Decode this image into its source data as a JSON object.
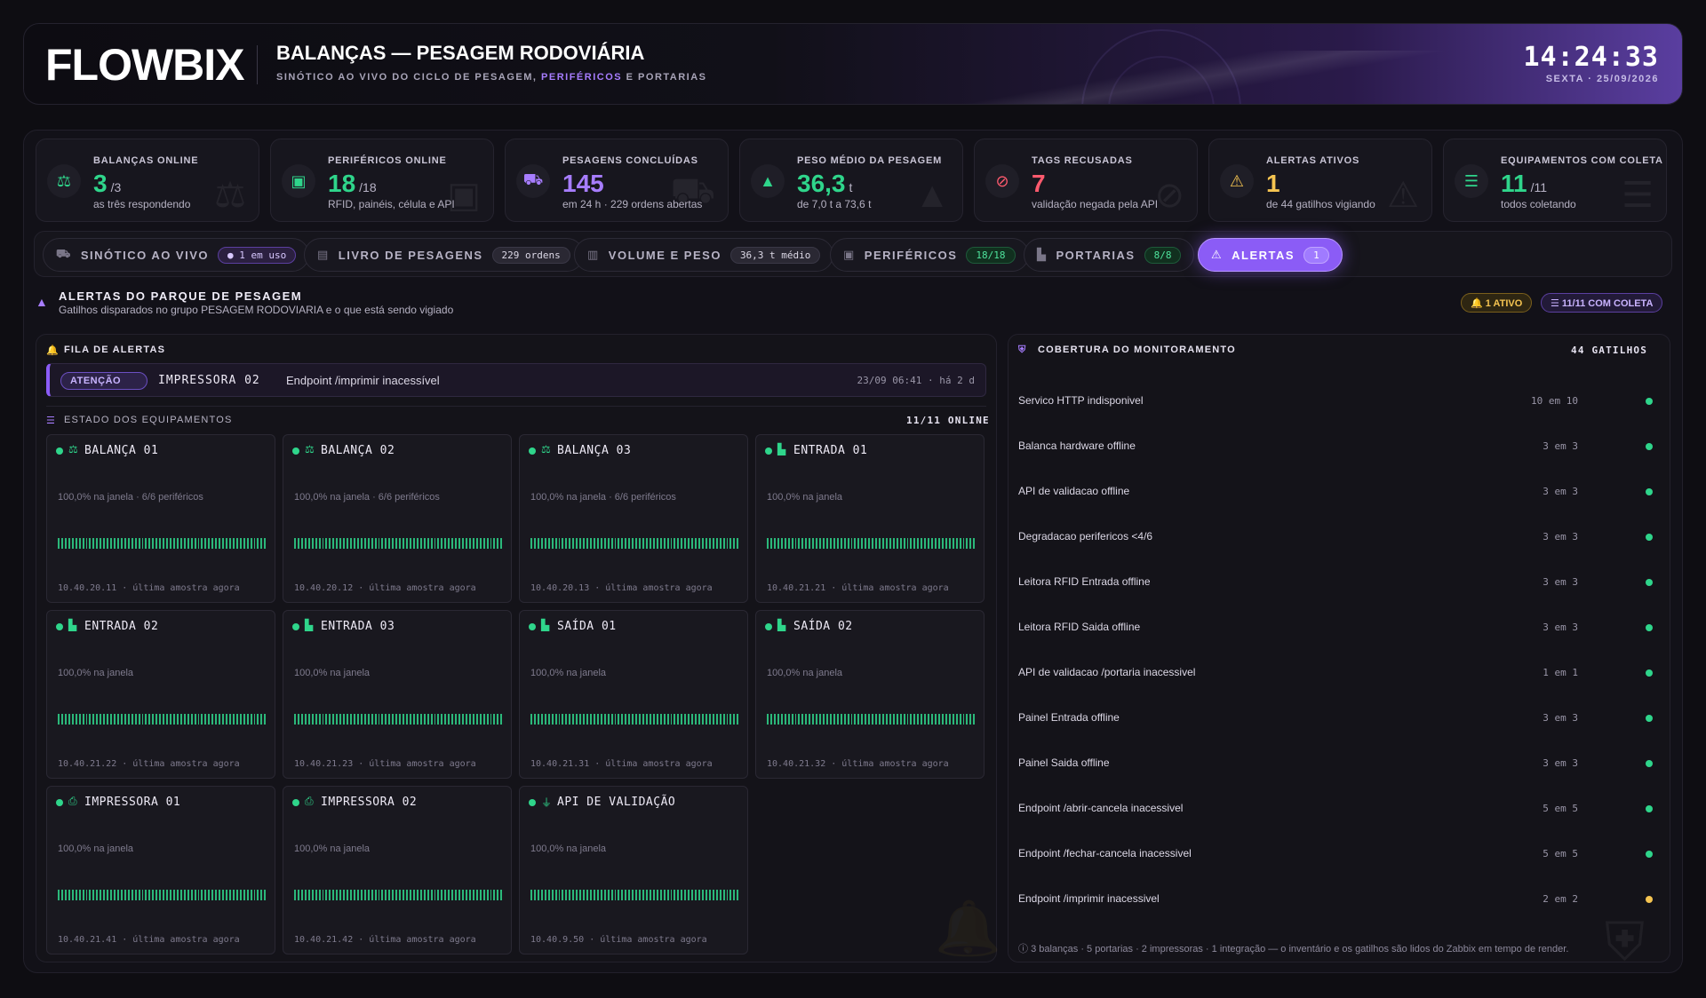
{
  "header": {
    "logo": "FLOWBIX",
    "title": "BALANÇAS — PESAGEM RODOVIÁRIA",
    "subtitle_pre": "SINÓTICO AO VIVO DO CICLO DE PESAGEM,",
    "subtitle_hl": "PERIFÉRICOS",
    "subtitle_post": "E PORTARIAS",
    "clock": "14:24:33",
    "date": "SEXTA · 25/09/2026"
  },
  "kpis": [
    {
      "icon": "scale-icon",
      "label": "BALANÇAS ONLINE",
      "value": "3",
      "unit": "/3",
      "desc": "as três respondendo",
      "color": "#2fd58b"
    },
    {
      "icon": "chip-icon",
      "label": "PERIFÉRICOS ONLINE",
      "value": "18",
      "unit": "/18",
      "desc": "RFID, painéis, célula e API",
      "color": "#2fd58b"
    },
    {
      "icon": "truck-icon",
      "label": "PESAGENS CONCLUÍDAS",
      "value": "145",
      "unit": "",
      "desc": "em 24 h · 229 ordens abertas",
      "color": "#a77dff"
    },
    {
      "icon": "weight-icon",
      "label": "PESO MÉDIO DA PESAGEM",
      "value": "36,3",
      "unit": "t",
      "desc": "de 7,0 t a 73,6 t",
      "color": "#2fd58b"
    },
    {
      "icon": "block-icon",
      "label": "TAGS RECUSADAS",
      "value": "7",
      "unit": "",
      "desc": "validação negada pela API",
      "color": "#ff5a6e"
    },
    {
      "icon": "warning-icon",
      "label": "ALERTAS ATIVOS",
      "value": "1",
      "unit": "",
      "desc": "de 44 gatilhos vigiando",
      "color": "#f5c451"
    },
    {
      "icon": "server-icon",
      "label": "EQUIPAMENTOS COM COLETA",
      "value": "11",
      "unit": "/11",
      "desc": "todos coletando",
      "color": "#2fd58b"
    }
  ],
  "tabs": [
    {
      "icon": "truck-icon",
      "label": "SINÓTICO AO VIVO",
      "pill": "● 1 em uso"
    },
    {
      "icon": "book-icon",
      "label": "LIVRO DE PESAGENS",
      "pill": "229 ordens"
    },
    {
      "icon": "chart-icon",
      "label": "VOLUME E PESO",
      "pill": "36,3 t médio"
    },
    {
      "icon": "chip-icon",
      "label": "PERIFÉRICOS",
      "pill": "18/18"
    },
    {
      "icon": "gate-icon",
      "label": "PORTARIAS",
      "pill": "8/8"
    },
    {
      "icon": "warning-icon",
      "label": "ALERTAS",
      "pill": "1"
    }
  ],
  "alerts_section": {
    "title": "ALERTAS DO PARQUE DE PESAGEM",
    "subtitle": "Gatilhos disparados no grupo PESAGEM RODOVIARIA e o que está sendo vigiado",
    "badge_active": "🔔 1 ATIVO",
    "badge_coleta": "☰ 11/11 COM COLETA"
  },
  "queue": {
    "title": "FILA DE ALERTAS",
    "items": [
      {
        "severity": "ATENÇÃO",
        "device": "IMPRESSORA 02",
        "message": "Endpoint /imprimir inacessível",
        "when": "23/09 06:41 · há 2 d"
      }
    ]
  },
  "equipment": {
    "title": "ESTADO DOS EQUIPAMENTOS",
    "summary": "11/11 ONLINE",
    "items": [
      {
        "icon": "scale-icon",
        "name": "BALANÇA 01",
        "info": "100,0% na janela · 6/6 periféricos",
        "foot": "10.40.20.11 · última amostra agora"
      },
      {
        "icon": "scale-icon",
        "name": "BALANÇA 02",
        "info": "100,0% na janela · 6/6 periféricos",
        "foot": "10.40.20.12 · última amostra agora"
      },
      {
        "icon": "scale-icon",
        "name": "BALANÇA 03",
        "info": "100,0% na janela · 6/6 periféricos",
        "foot": "10.40.20.13 · última amostra agora"
      },
      {
        "icon": "gate-icon",
        "name": "ENTRADA 01",
        "info": "100,0% na janela",
        "foot": "10.40.21.21 · última amostra agora"
      },
      {
        "icon": "gate-icon",
        "name": "ENTRADA 02",
        "info": "100,0% na janela",
        "foot": "10.40.21.22 · última amostra agora"
      },
      {
        "icon": "gate-icon",
        "name": "ENTRADA 03",
        "info": "100,0% na janela",
        "foot": "10.40.21.23 · última amostra agora"
      },
      {
        "icon": "gate-icon",
        "name": "SAÍDA 01",
        "info": "100,0% na janela",
        "foot": "10.40.21.31 · última amostra agora"
      },
      {
        "icon": "gate-icon",
        "name": "SAÍDA 02",
        "info": "100,0% na janela",
        "foot": "10.40.21.32 · última amostra agora"
      },
      {
        "icon": "printer-icon",
        "name": "IMPRESSORA 01",
        "info": "100,0% na janela",
        "foot": "10.40.21.41 · última amostra agora"
      },
      {
        "icon": "printer-icon",
        "name": "IMPRESSORA 02",
        "info": "100,0% na janela",
        "foot": "10.40.21.42 · última amostra agora"
      },
      {
        "icon": "plug-icon",
        "name": "API DE VALIDAÇÃO",
        "info": "100,0% na janela",
        "foot": "10.40.9.50 · última amostra agora"
      }
    ]
  },
  "coverage": {
    "title": "COBERTURA DO MONITORAMENTO",
    "count": "44 GATILHOS",
    "items": [
      {
        "name": "Servico HTTP indisponivel",
        "count": "10 em 10",
        "status": "ok"
      },
      {
        "name": "Balanca hardware offline",
        "count": "3 em 3",
        "status": "ok"
      },
      {
        "name": "API de validacao offline",
        "count": "3 em 3",
        "status": "ok"
      },
      {
        "name": "Degradacao perifericos <4/6",
        "count": "3 em 3",
        "status": "ok"
      },
      {
        "name": "Leitora RFID Entrada offline",
        "count": "3 em 3",
        "status": "ok"
      },
      {
        "name": "Leitora RFID Saida offline",
        "count": "3 em 3",
        "status": "ok"
      },
      {
        "name": "API de validacao /portaria inacessivel",
        "count": "1 em 1",
        "status": "ok"
      },
      {
        "name": "Painel Entrada offline",
        "count": "3 em 3",
        "status": "ok"
      },
      {
        "name": "Painel Saida offline",
        "count": "3 em 3",
        "status": "ok"
      },
      {
        "name": "Endpoint /abrir-cancela inacessivel",
        "count": "5 em 5",
        "status": "ok"
      },
      {
        "name": "Endpoint /fechar-cancela inacessivel",
        "count": "5 em 5",
        "status": "ok"
      },
      {
        "name": "Endpoint /imprimir inacessivel",
        "count": "2 em 2",
        "status": "warn"
      }
    ],
    "footnote": "3 balanças · 5 portarias · 2 impressoras · 1 integração — o inventário e os gatilhos são lidos do Zabbix em tempo de render."
  }
}
